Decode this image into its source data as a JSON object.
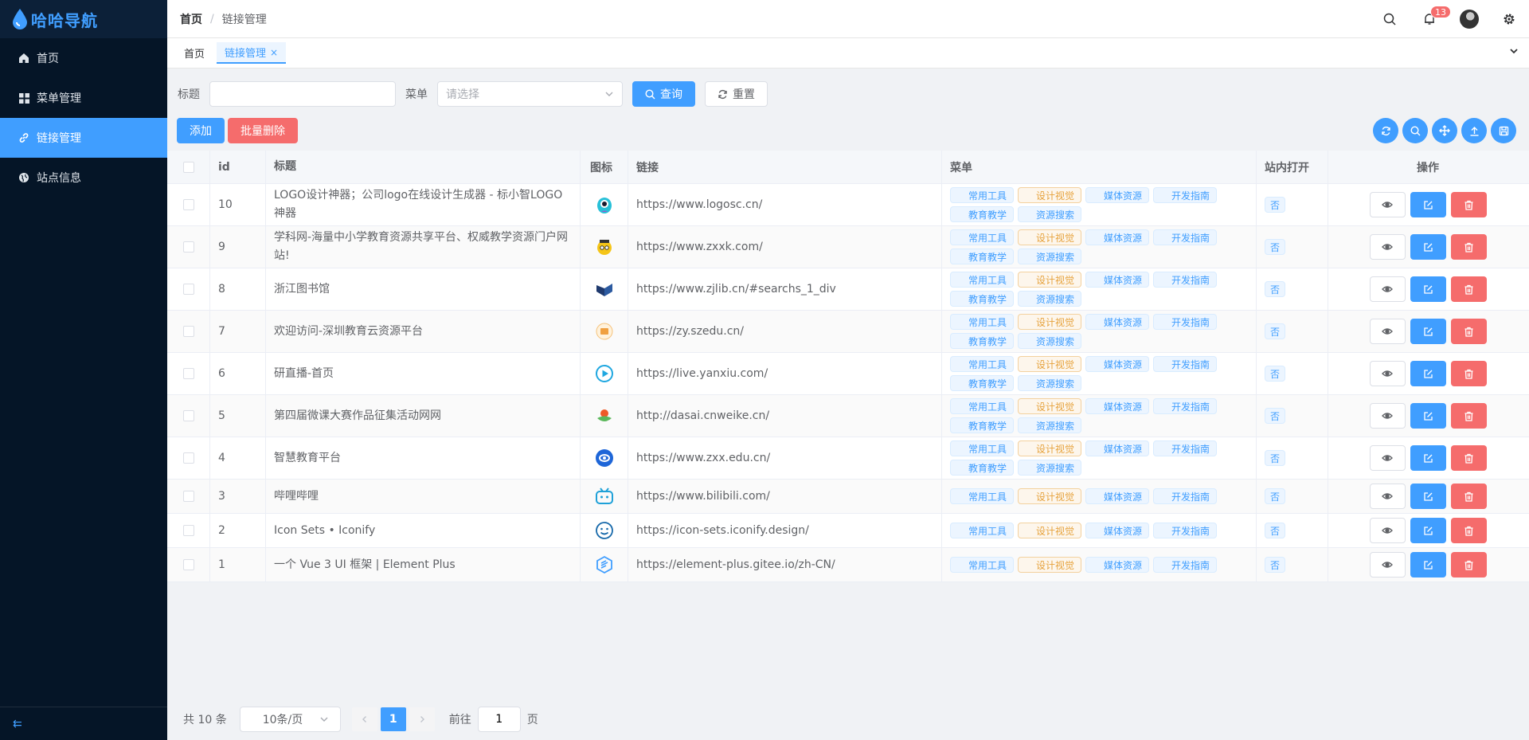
{
  "app": {
    "logo_text": "哈哈导航"
  },
  "sidebar": {
    "items": [
      {
        "label": "首页",
        "icon": "home-icon"
      },
      {
        "label": "菜单管理",
        "icon": "grid-icon"
      },
      {
        "label": "链接管理",
        "icon": "link-icon",
        "active": true
      },
      {
        "label": "站点信息",
        "icon": "globe-icon"
      }
    ],
    "collapse_icon": "⇇"
  },
  "header": {
    "breadcrumb": {
      "home": "首页",
      "separator": "/",
      "current": "链接管理"
    },
    "notification_count": "13"
  },
  "tabs": [
    {
      "label": "首页"
    },
    {
      "label": "链接管理",
      "active": true,
      "close": "×"
    }
  ],
  "search": {
    "title_label": "标题",
    "title_value": "",
    "menu_label": "菜单",
    "menu_placeholder": "请选择",
    "query_button": "查询",
    "reset_button": "重置"
  },
  "toolbar": {
    "add_button": "添加",
    "batch_delete_button": "批量删除"
  },
  "table": {
    "columns": [
      "id",
      "标题",
      "图标",
      "链接",
      "菜单",
      "站内打开",
      "操作"
    ],
    "rows": [
      {
        "id": "10",
        "title": "LOGO设计神器；公司logo在线设计生成器 - 标小智LOGO神器",
        "icon": "logosc-icon",
        "link": "https://www.logosc.cn/",
        "menus": [
          "常用工具",
          "设计视觉",
          "媒体资源",
          "开发指南",
          "教育教学",
          "资源搜索"
        ],
        "open": "否"
      },
      {
        "id": "9",
        "title": "学科网-海量中小学教育资源共享平台、权威教学资源门户网站!",
        "icon": "zxxk-icon",
        "link": "https://www.zxxk.com/",
        "menus": [
          "常用工具",
          "设计视觉",
          "媒体资源",
          "开发指南",
          "教育教学",
          "资源搜索"
        ],
        "open": "否"
      },
      {
        "id": "8",
        "title": "浙江图书馆",
        "icon": "zjlib-icon",
        "link": "https://www.zjlib.cn/#searchs_1_div",
        "menus": [
          "常用工具",
          "设计视觉",
          "媒体资源",
          "开发指南",
          "教育教学",
          "资源搜索"
        ],
        "open": "否"
      },
      {
        "id": "7",
        "title": "欢迎访问-深圳教育云资源平台",
        "icon": "szedu-icon",
        "link": "https://zy.szedu.cn/",
        "menus": [
          "常用工具",
          "设计视觉",
          "媒体资源",
          "开发指南",
          "教育教学",
          "资源搜索"
        ],
        "open": "否"
      },
      {
        "id": "6",
        "title": "研直播-首页",
        "icon": "yanxiu-icon",
        "link": "https://live.yanxiu.com/",
        "menus": [
          "常用工具",
          "设计视觉",
          "媒体资源",
          "开发指南",
          "教育教学",
          "资源搜索"
        ],
        "open": "否"
      },
      {
        "id": "5",
        "title": "第四届微课大赛作品征集活动网网",
        "icon": "cnweike-icon",
        "link": "http://dasai.cnweike.cn/",
        "menus": [
          "常用工具",
          "设计视觉",
          "媒体资源",
          "开发指南",
          "教育教学",
          "资源搜索"
        ],
        "open": "否"
      },
      {
        "id": "4",
        "title": "智慧教育平台",
        "icon": "zxx-icon",
        "link": "https://www.zxx.edu.cn/",
        "menus": [
          "常用工具",
          "设计视觉",
          "媒体资源",
          "开发指南",
          "教育教学",
          "资源搜索"
        ],
        "open": "否"
      },
      {
        "id": "3",
        "title": "哔哩哔哩",
        "icon": "bilibili-icon",
        "link": "https://www.bilibili.com/",
        "menus": [
          "常用工具",
          "设计视觉",
          "媒体资源",
          "开发指南"
        ],
        "open": "否"
      },
      {
        "id": "2",
        "title": "Icon Sets • Iconify",
        "icon": "iconify-icon",
        "link": "https://icon-sets.iconify.design/",
        "menus": [
          "常用工具",
          "设计视觉",
          "媒体资源",
          "开发指南"
        ],
        "open": "否"
      },
      {
        "id": "1",
        "title": "一个 Vue 3 UI 框架 | Element Plus",
        "icon": "element-plus-icon",
        "link": "https://element-plus.gitee.io/zh-CN/",
        "menus": [
          "常用工具",
          "设计视觉",
          "媒体资源",
          "开发指南"
        ],
        "open": "否"
      }
    ]
  },
  "pagination": {
    "total_text": "共 10 条",
    "page_size": "10条/页",
    "current_page": "1",
    "goto_label": "前往",
    "goto_value": "1",
    "page_suffix": "页"
  },
  "colors": {
    "primary": "#409eff",
    "danger": "#f56c6c",
    "warning": "#e6a23c",
    "sidebar_bg": "#051527"
  }
}
